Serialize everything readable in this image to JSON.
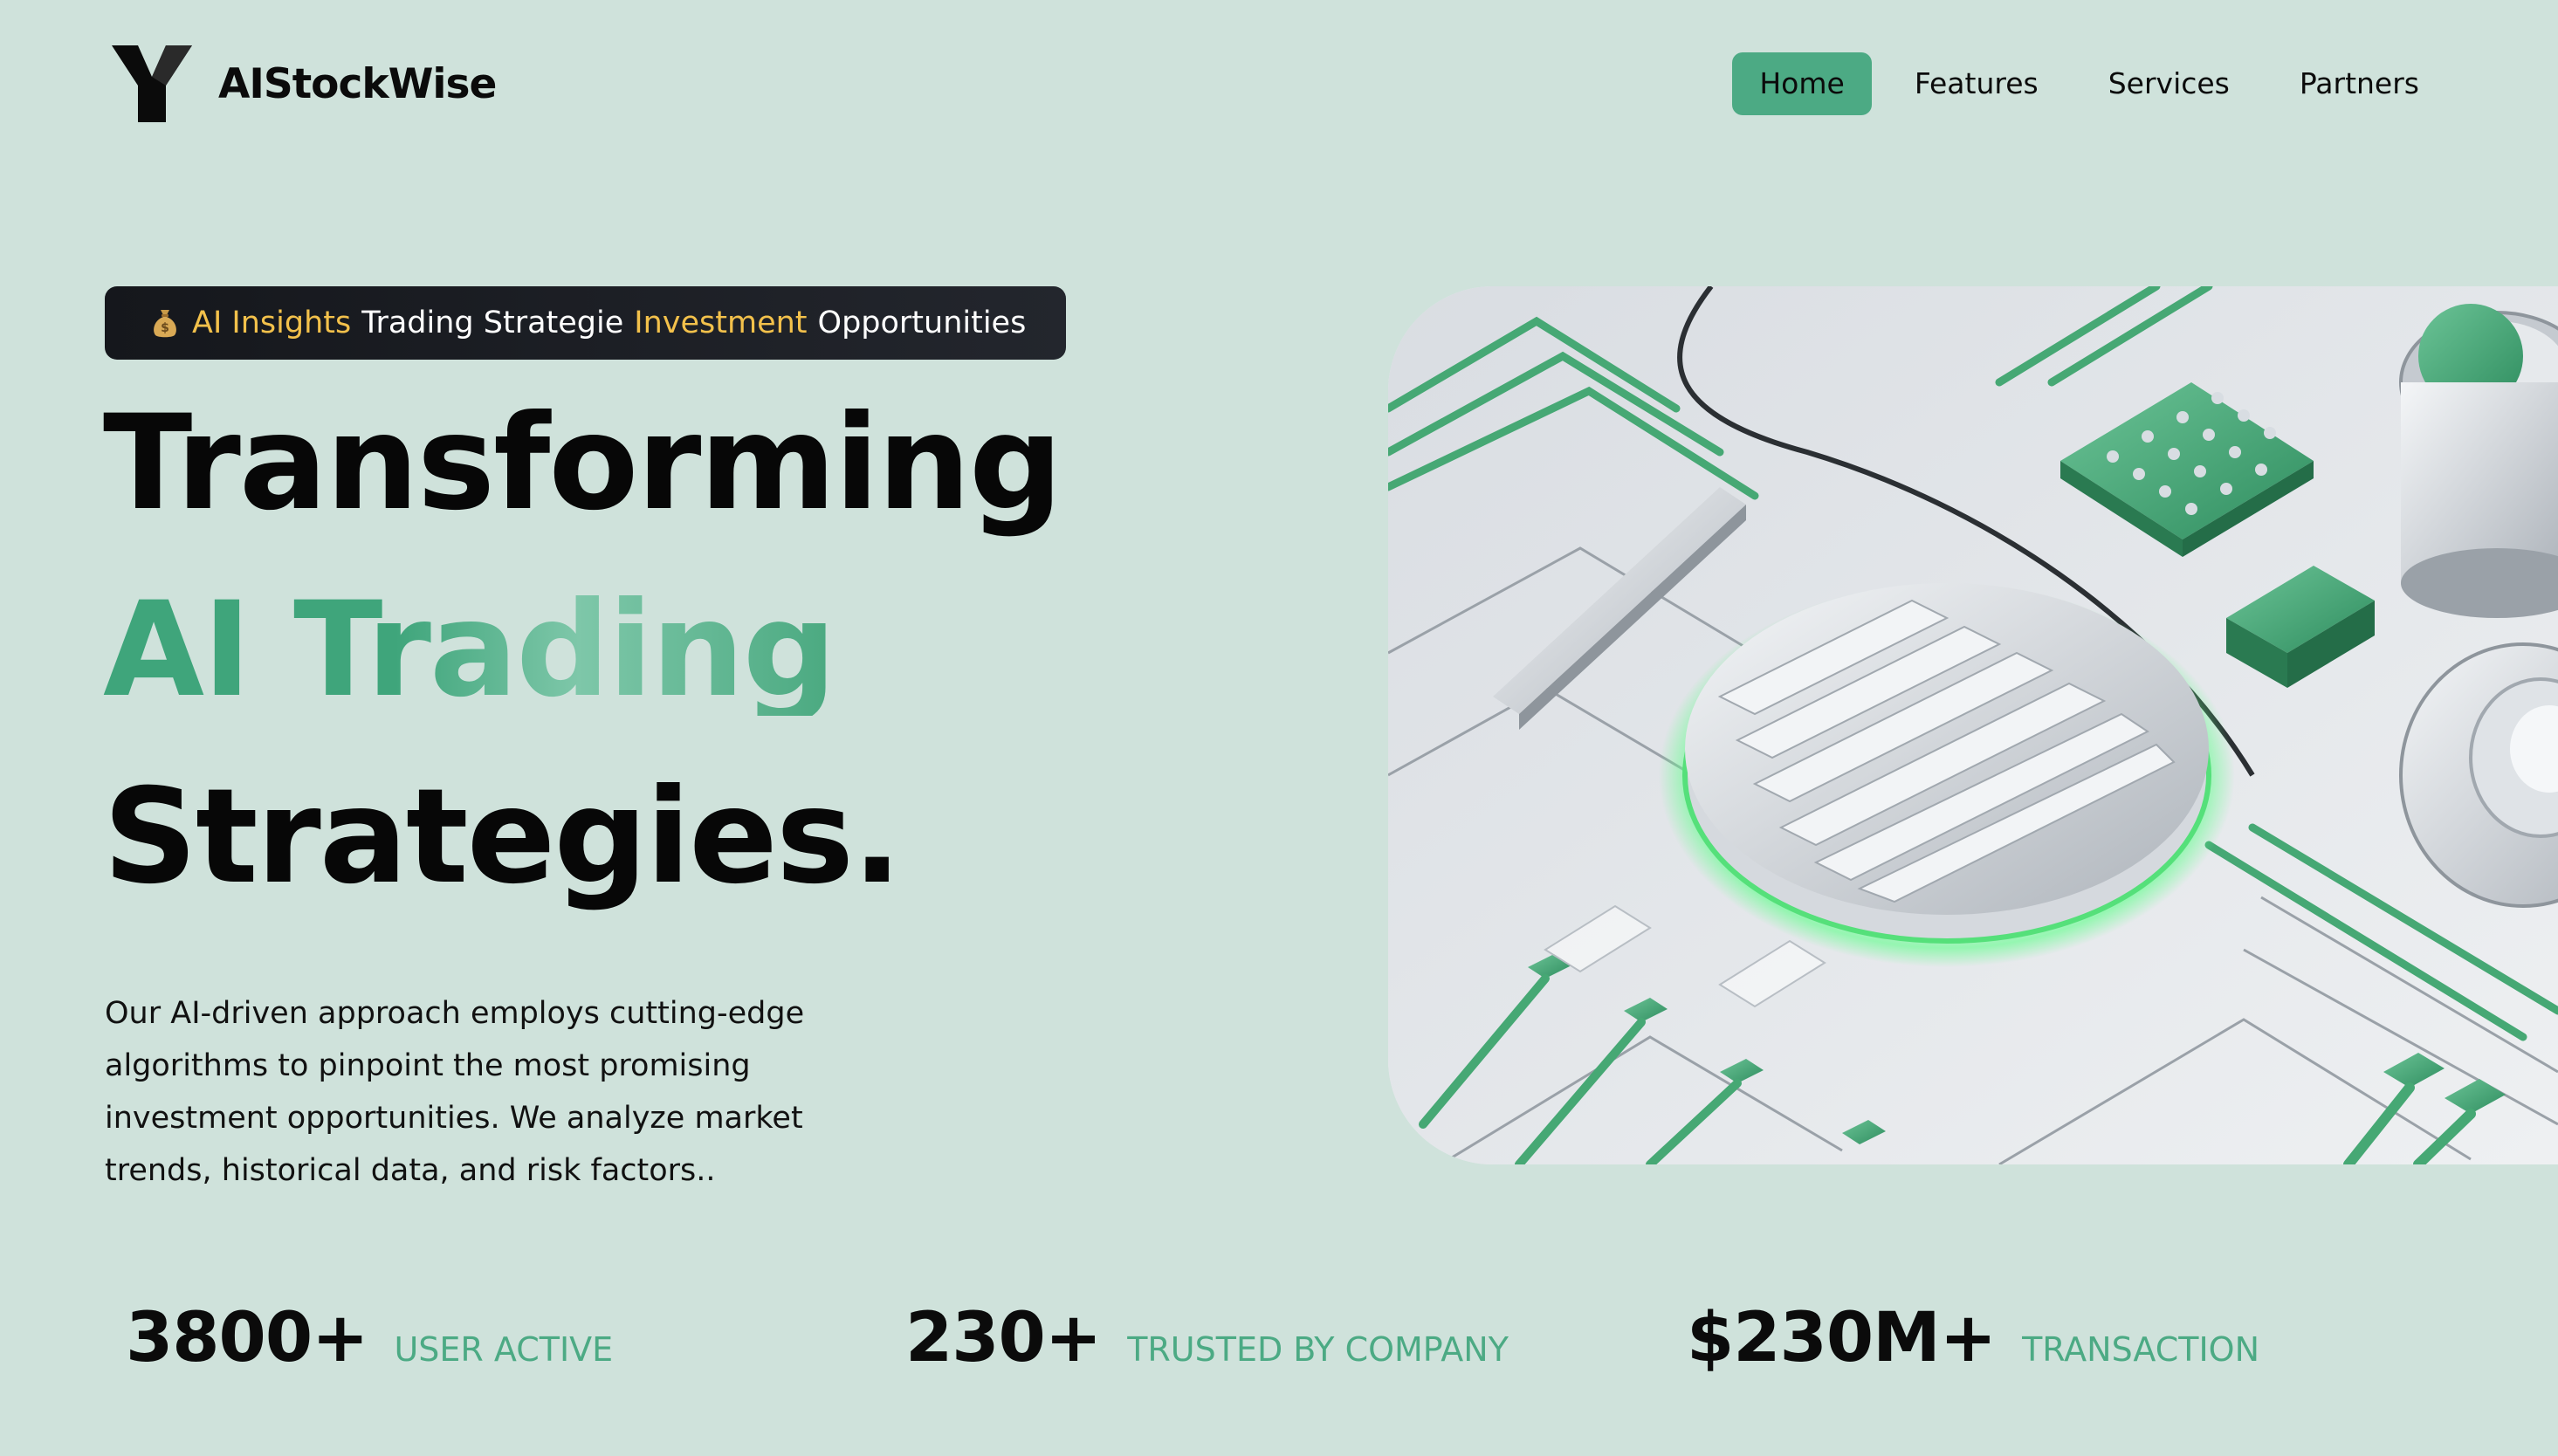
{
  "brand": {
    "name": "AIStockWise",
    "logo_icon": "y-logo-icon"
  },
  "nav": {
    "items": [
      {
        "label": "Home",
        "active": true
      },
      {
        "label": "Features",
        "active": false
      },
      {
        "label": "Services",
        "active": false
      },
      {
        "label": "Partners",
        "active": false
      }
    ]
  },
  "hero": {
    "badge": {
      "icon": "money-bag-icon",
      "part1": "AI Insights",
      "part2": "Trading Strategie",
      "part3": "Investment",
      "part4": "Opportunities"
    },
    "headline_line1": "Transforming",
    "headline_line2": "AI Trading",
    "headline_line3": "Strategies.",
    "description": "Our AI-driven approach employs cutting-edge algorithms to pinpoint the most promising investment opportunities. We analyze market trends, historical data, and risk factors..",
    "image_icon": "circuit-board-illustration"
  },
  "stats": [
    {
      "value": "3800+",
      "label": "USER ACTIVE"
    },
    {
      "value": "230+",
      "label": "TRUSTED BY COMPANY"
    },
    {
      "value": "$230M+",
      "label": "TRANSACTION"
    }
  ],
  "colors": {
    "background": "#cfe2db",
    "accent": "#4caa84",
    "badge_gold": "#f3c14b",
    "dark": "#15171c"
  }
}
